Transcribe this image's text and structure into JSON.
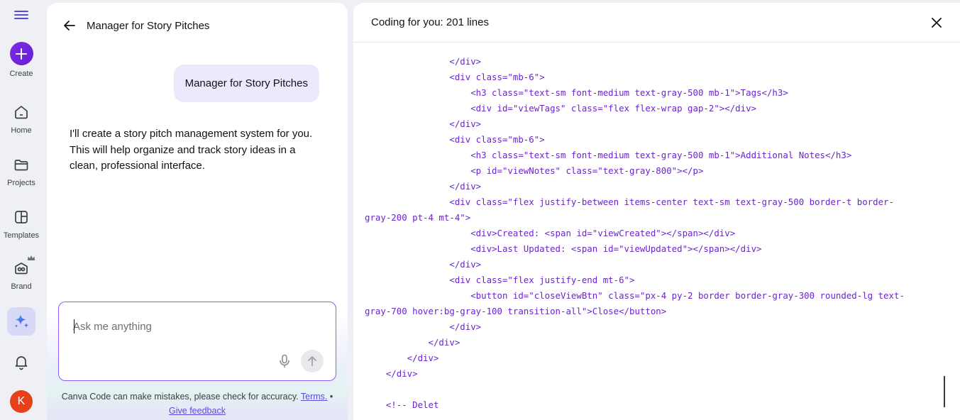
{
  "rail": {
    "create_label": "Create",
    "items": [
      {
        "label": "Home",
        "icon": "home-icon"
      },
      {
        "label": "Projects",
        "icon": "folder-icon"
      },
      {
        "label": "Templates",
        "icon": "templates-icon"
      },
      {
        "label": "Brand",
        "icon": "brand-icon"
      }
    ],
    "avatar_initial": "K",
    "accent": "#7d2ae8",
    "avatar_color": "#e5421c"
  },
  "chat": {
    "title": "Manager for Story Pitches",
    "user_message": "Manager for Story Pitches",
    "assistant_message": "I'll create a story pitch management system for you. This will help organize and track story ideas in a clean, professional interface.",
    "input_placeholder": "Ask me anything",
    "input_value": "",
    "disclaimer_text": "Canva Code can make mistakes, please check for accuracy.",
    "terms_link": "Terms.",
    "separator": "•",
    "feedback_link": "Give feedback"
  },
  "code": {
    "title": "Coding for you: 201 lines",
    "lines": [
      "                </div>",
      "                <div class=\"mb-6\">",
      "                    <h3 class=\"text-sm font-medium text-gray-500 mb-1\">Tags</h3>",
      "                    <div id=\"viewTags\" class=\"flex flex-wrap gap-2\"></div>",
      "                </div>",
      "                <div class=\"mb-6\">",
      "                    <h3 class=\"text-sm font-medium text-gray-500 mb-1\">Additional Notes</h3>",
      "                    <p id=\"viewNotes\" class=\"text-gray-800\"></p>",
      "                </div>",
      "                <div class=\"flex justify-between items-center text-sm text-gray-500 border-t border-",
      "gray-200 pt-4 mt-4\">",
      "                    <div>Created: <span id=\"viewCreated\"></span></div>",
      "                    <div>Last Updated: <span id=\"viewUpdated\"></span></div>",
      "                </div>",
      "                <div class=\"flex justify-end mt-6\">",
      "                    <button id=\"closeViewBtn\" class=\"px-4 py-2 border border-gray-300 rounded-lg text-",
      "gray-700 hover:bg-gray-100 transition-all\">Close</button>",
      "                </div>",
      "            </div>",
      "        </div>",
      "    </div>",
      "",
      "    <!-- Delet"
    ],
    "code_color": "#6a26c9"
  }
}
